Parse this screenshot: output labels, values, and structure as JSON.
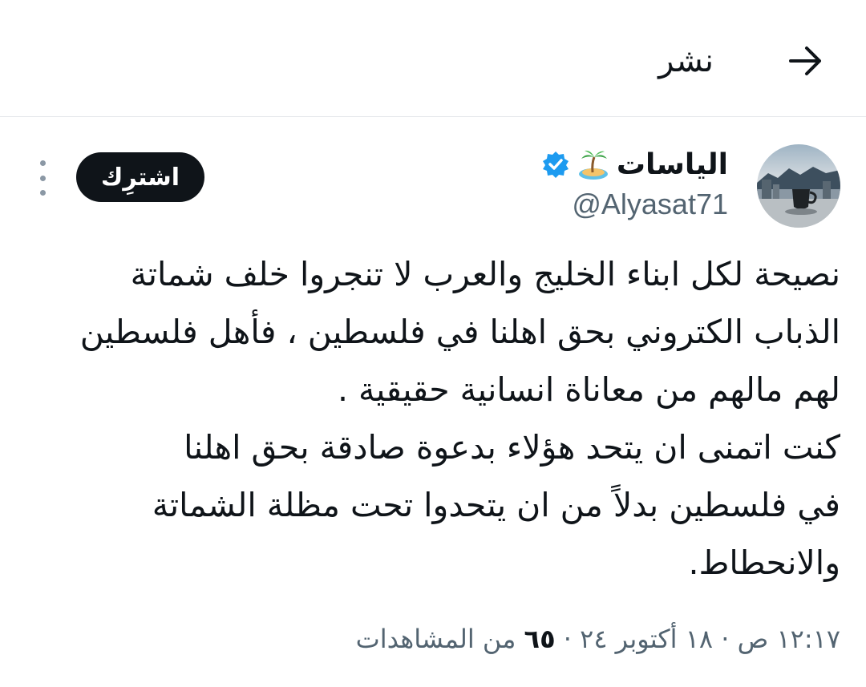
{
  "header": {
    "title": "نشر",
    "back_icon": "arrow-right-icon"
  },
  "author": {
    "name": "الياسات",
    "emoji": "desert-island-emoji",
    "verified_icon": "verified-badge-icon",
    "verified_color": "#1d9bf0",
    "handle": "@Alyasat71"
  },
  "subscribe_label": "اشترِك",
  "more_icon": "more-vertical-icon",
  "tweet": {
    "lines": [
      "نصيحة لكل ابناء الخليج والعرب لا تنجروا خلف شماتة",
      "الذباب الكتروني بحق اهلنا في فلسطين ، فأهل فلسطين",
      "لهم مالهم من معاناة انسانية حقيقية .",
      "كنت اتمنى ان يتحد هؤلاء بدعوة صادقة بحق اهلنا",
      "في فلسطين بدلاً من ان يتحدوا تحت مظلة الشماتة",
      "والانحطاط."
    ]
  },
  "meta": {
    "time": "١٢:١٧ ص",
    "date": "١٨ أكتوبر ٢٤",
    "separator": "·",
    "views_count": "٦٥",
    "views_label": "من المشاهدات"
  }
}
